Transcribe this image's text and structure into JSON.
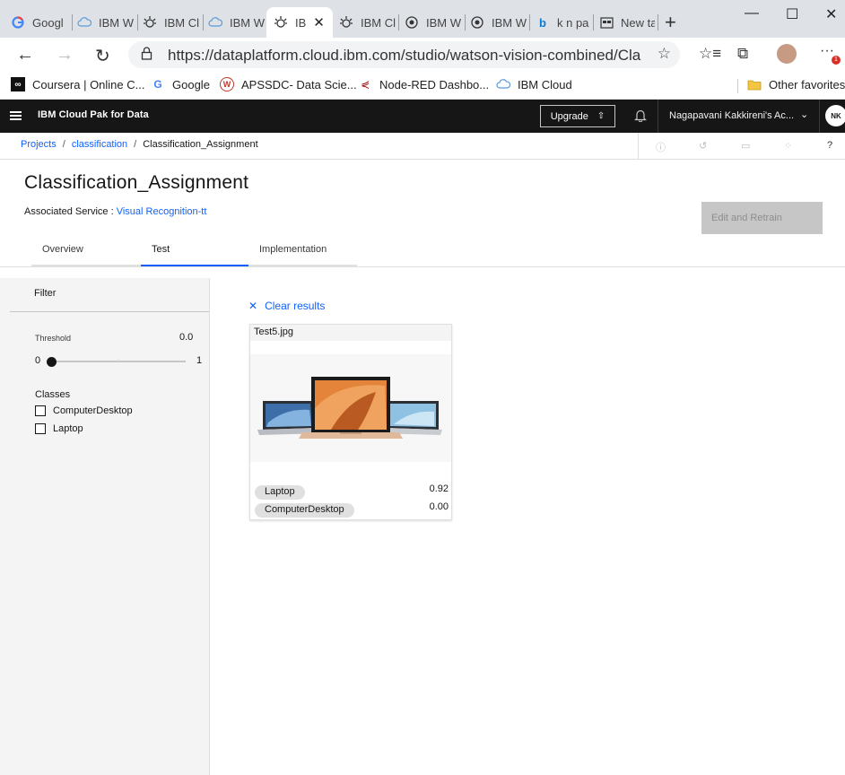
{
  "browser": {
    "tabs": [
      {
        "label": "Googl",
        "icon": "google-icon"
      },
      {
        "label": "IBM W",
        "icon": "ibm-cloud-icon"
      },
      {
        "label": "IBM Cl",
        "icon": "watson-icon"
      },
      {
        "label": "IBM W",
        "icon": "ibm-cloud-icon"
      },
      {
        "label": "IB",
        "icon": "watson-icon",
        "active": true
      },
      {
        "label": "IBM Cl",
        "icon": "watson-icon"
      },
      {
        "label": "IBM W",
        "icon": "watson-studio-icon"
      },
      {
        "label": "IBM W",
        "icon": "watson-studio-icon"
      },
      {
        "label": "k n pa",
        "icon": "bing-icon"
      },
      {
        "label": "New ta",
        "icon": "new-tab-icon"
      }
    ],
    "url": "https://dataplatform.cloud.ibm.com/studio/watson-vision-combined/Cla...",
    "notification_count": "1",
    "bookmarks": [
      {
        "label": "Coursera | Online C...",
        "icon": "coursera-icon"
      },
      {
        "label": "Google",
        "icon": "google-icon"
      },
      {
        "label": "APSSDC- Data Scie...",
        "icon": "apssdc-icon"
      },
      {
        "label": "Node-RED Dashbo...",
        "icon": "node-red-icon"
      },
      {
        "label": "IBM Cloud",
        "icon": "ibm-cloud-icon"
      }
    ],
    "other_favorites": "Other favorites"
  },
  "app": {
    "brand": "IBM Cloud Pak for Data",
    "upgrade_label": "Upgrade",
    "account": "Nagapavani Kakkireni's Ac...",
    "avatar_initials": "NK"
  },
  "breadcrumb": {
    "projects": "Projects",
    "classification": "classification",
    "current": "Classification_Assignment"
  },
  "page": {
    "title": "Classification_Assignment",
    "assoc_label": "Associated Service :",
    "assoc_link": "Visual Recognition-tt",
    "retrain_label": "Edit and Retrain",
    "tabs": [
      "Overview",
      "Test",
      "Implementation"
    ],
    "selected_tab": "Test"
  },
  "filter": {
    "heading": "Filter",
    "threshold_label": "Threshold",
    "threshold_value": "0.0",
    "slider_min": "0",
    "slider_max": "1",
    "slider_level": 0,
    "classes_heading": "Classes",
    "classes": [
      "ComputerDesktop",
      "Laptop"
    ]
  },
  "results": {
    "clear_label": "Clear results",
    "card": {
      "filename": "Test5.jpg",
      "image_desc_icon": "laptops-image",
      "scores": [
        {
          "label": "Laptop",
          "score": "0.92"
        },
        {
          "label": "ComputerDesktop",
          "score": "0.00"
        }
      ]
    }
  },
  "colors": {
    "header_bg": "#161616",
    "link": "#0f62fe",
    "panel_bg": "#f4f4f4",
    "disabled_btn": "#c6c6c6"
  }
}
